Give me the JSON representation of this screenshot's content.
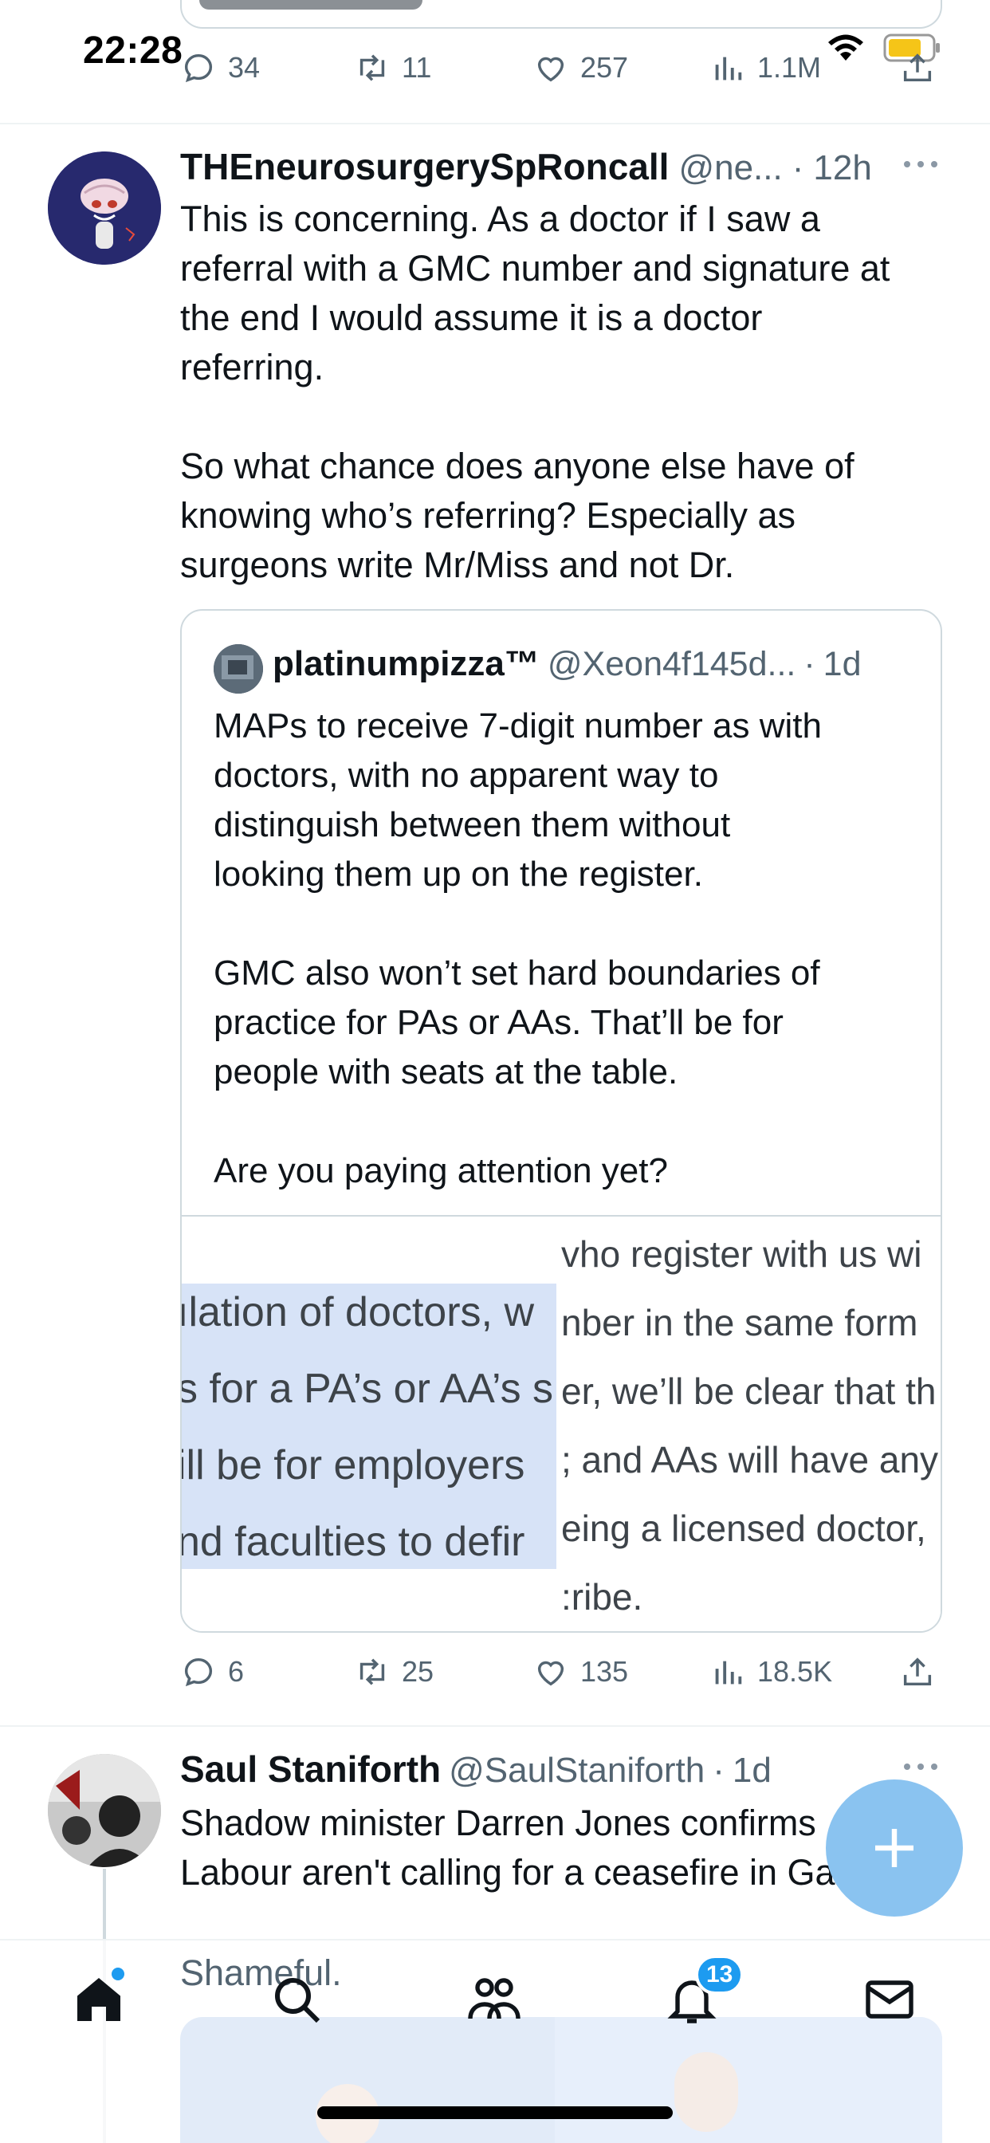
{
  "status_bar": {
    "time": "22:28"
  },
  "prev_tweet": {
    "replies": "34",
    "retweets": "11",
    "likes": "257",
    "views": "1.1M"
  },
  "tweet": {
    "display_name": "THEneurosurgerySpRoncall",
    "handle": "@ne...",
    "separator": "·",
    "time": "12h",
    "text_p1": "This is concerning. As a doctor if I saw a\nreferral with a GMC number and signature at\nthe end I would assume it is a doctor\nreferring.",
    "text_p2": "So what chance does anyone else have of\nknowing who’s referring? Especially as\nsurgeons write Mr/Miss and not Dr.",
    "quote": {
      "display_name": "platinumpizza™",
      "handle": "@Xeon4f145d...",
      "separator": "·",
      "time": "1d",
      "text": "MAPs to receive 7-digit number as with\ndoctors, with no apparent way to\ndistinguish between them without\nlooking them up on the register.\n\nGMC also won’t set hard boundaries of\npractice for PAs or AAs. That’ll be for\npeople with seats at the table.\n\nAre you paying attention yet?",
      "image_left_lines": [
        "ılation of doctors, w",
        "s for a PA’s or AA’s s",
        "ill be for employers",
        "nd faculties to defir"
      ],
      "image_right_lines": [
        "vho register with us wi",
        "nber in the same form",
        "er, we’ll be clear that th",
        "; and AAs will have any",
        "eing a licensed doctor,",
        ":ribe."
      ]
    },
    "replies": "6",
    "retweets": "25",
    "likes": "135",
    "views": "18.5K"
  },
  "next_tweet": {
    "display_name": "Saul Staniforth",
    "handle": "@SaulStaniforth",
    "separator": "·",
    "time": "1d",
    "text": "Shadow minister Darren Jones confirms\nLabour aren't calling for a ceasefire in Gaza.",
    "text2": "Shameful."
  },
  "nav": {
    "notifications_badge": "13"
  },
  "colors": {
    "accent": "#1d9bf0",
    "fab": "#8ac3f0",
    "secondary_text": "#536471",
    "highlight": "#d7e3f7"
  },
  "icons": {
    "reply": "reply-icon",
    "retweet": "retweet-icon",
    "like": "heart-icon",
    "views": "views-icon",
    "share": "share-icon"
  }
}
